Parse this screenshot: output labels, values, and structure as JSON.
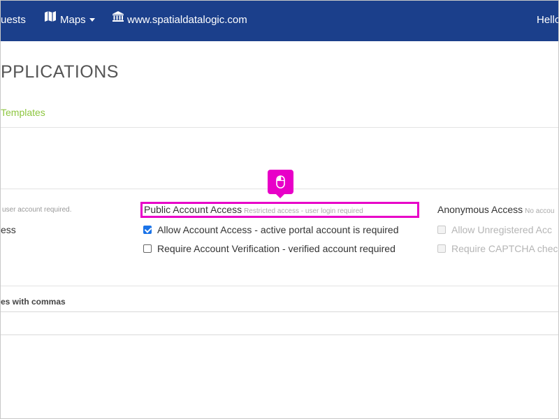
{
  "nav": {
    "requests_label": "uests",
    "maps_label": "Maps",
    "maps_icon": "map-icon",
    "site_label": "www.spatialdatalogic.com",
    "site_icon": "institution-icon",
    "user_label": "Hello"
  },
  "page": {
    "title": "PPLICATIONS",
    "templates_link": "Templates"
  },
  "left_column": {
    "note": "user account required.",
    "label": "ess"
  },
  "public_access": {
    "heading": "Public Account Access",
    "note": "Restricted access - user login required",
    "allow_label": "Allow Account Access - active portal account is required",
    "allow_checked": true,
    "verify_label": "Require Account Verification - verified account required",
    "verify_checked": false
  },
  "anonymous_access": {
    "heading": "Anonymous Access",
    "note": "No accou",
    "unregistered_label": "Allow Unregistered Acc",
    "captcha_label": "Require CAPTCHA chec"
  },
  "commas": {
    "label": "es with commas"
  },
  "overlay": {
    "highlight_color": "#e800c8",
    "cursor_icon": "mouse-icon"
  },
  "colors": {
    "topbar": "#1b3f8b",
    "link_green": "#8dc63f",
    "checkbox_blue": "#1a73e8"
  }
}
